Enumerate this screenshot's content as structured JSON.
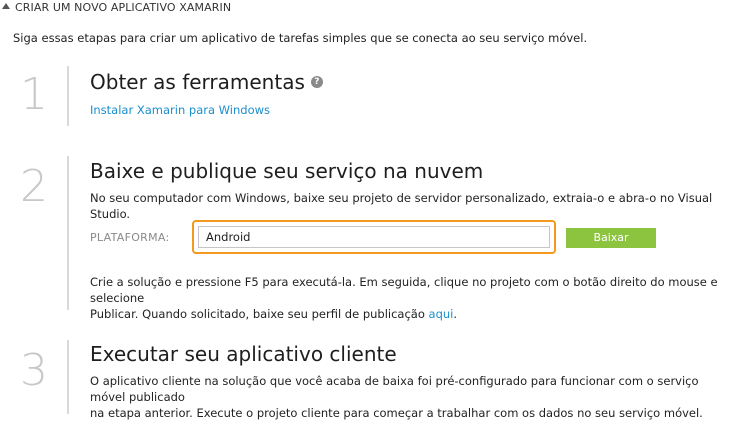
{
  "header": {
    "title": "CRIAR UM NOVO APLICATIVO XAMARIN"
  },
  "intro": "Siga essas etapas para criar um aplicativo de tarefas simples que se conecta ao seu serviço móvel.",
  "steps": [
    {
      "number": "1",
      "title": "Obter as ferramentas",
      "help_icon": "?",
      "link": "Instalar Xamarin para Windows"
    },
    {
      "number": "2",
      "title": "Baixe e publique seu serviço na nuvem",
      "description": "No seu computador com Windows, baixe seu projeto de servidor personalizado, extraia-o e abra-o no Visual Studio.",
      "platform_label": "PLATAFORMA:",
      "platform_value": "Android",
      "download_label": "Baixar",
      "publish_line1": "Crie a solução e pressione F5 para executá-la. Em seguida, clique no projeto com o botão direito do mouse e selecione",
      "publish_line2_prefix": "Publicar. Quando solicitado, baixe seu perfil de publicação",
      "publish_link": "aqui",
      "publish_suffix": "."
    },
    {
      "number": "3",
      "title": "Executar seu aplicativo cliente",
      "line1": "O aplicativo cliente na solução que você acaba de baixa foi pré-configurado para funcionar com o serviço móvel publicado",
      "line2": "na etapa anterior. Execute o projeto cliente para começar a trabalhar com os dados no seu serviço móvel."
    }
  ],
  "colors": {
    "link": "#1a8fcc",
    "highlight_border": "#f39a1e",
    "button_green": "#8cc33f",
    "step_number": "#c8c8c8"
  }
}
